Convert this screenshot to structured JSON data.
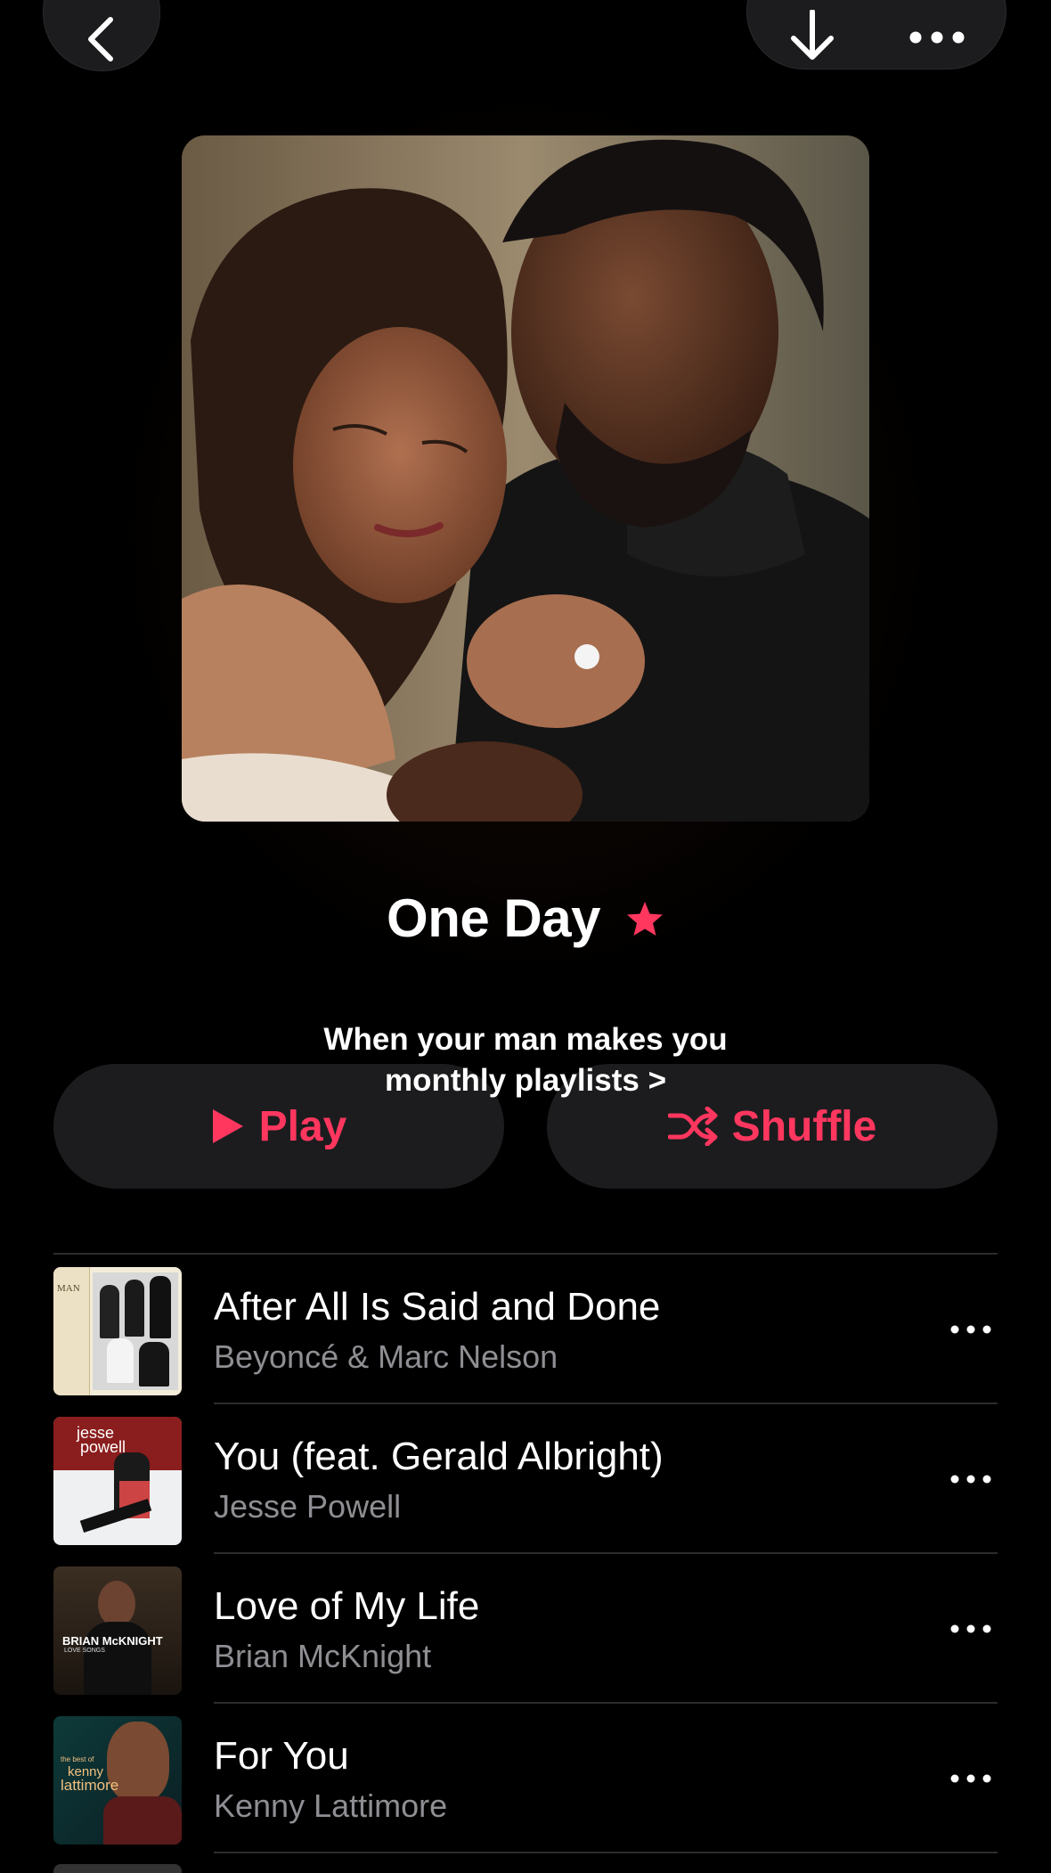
{
  "header": {
    "back_icon": "chevron-left-icon",
    "download_icon": "arrow-down-icon",
    "more_icon": "ellipsis-icon"
  },
  "playlist": {
    "title": "One Day",
    "badge_icon": "star-icon",
    "description_line1": "When your man makes you",
    "description_line2": "monthly playlists >"
  },
  "actions": {
    "play_label": "Play",
    "shuffle_label": "Shuffle"
  },
  "colors": {
    "accent": "#ff375f",
    "background": "#000000",
    "surface": "#1c1c1e",
    "secondary_text": "#8e8e93"
  },
  "tracks": [
    {
      "title": "After All Is Said and Done",
      "artist": "Beyoncé & Marc Nelson"
    },
    {
      "title": "You (feat. Gerald Albright)",
      "artist": "Jesse Powell"
    },
    {
      "title": "Love of My Life",
      "artist": "Brian McKnight"
    },
    {
      "title": "For You",
      "artist": "Kenny Lattimore"
    }
  ],
  "artwork_text": {
    "t1": "MAN",
    "t2a": "jesse",
    "t2b": "powell",
    "t3a": "BRIAN McKNIGHT",
    "t3b": "LOVE SONGS",
    "t4a": "the best of",
    "t4b": "kenny",
    "t4c": "lattimore"
  }
}
